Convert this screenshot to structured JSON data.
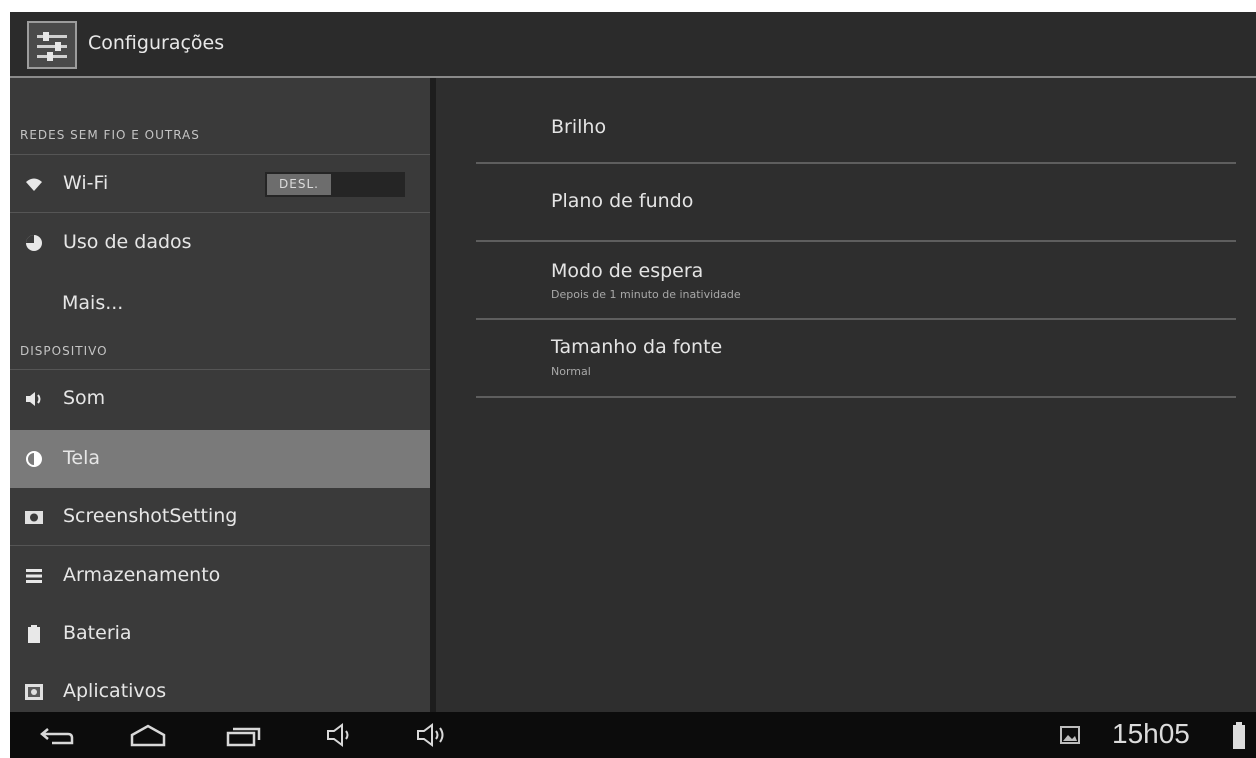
{
  "actionbar": {
    "title": "Configurações",
    "app_icon": "settings-icon"
  },
  "sections": [
    {
      "label": "REDES SEM FIO E OUTRAS"
    },
    {
      "label": "DISPOSITIVO"
    }
  ],
  "wifi": {
    "label": "Wi-Fi",
    "icon": "wifi-icon",
    "toggle_label": "DESL."
  },
  "items": [
    {
      "label": "Uso de dados",
      "icon": "data-usage-icon"
    },
    {
      "label": "Mais..."
    },
    {
      "label": "Som",
      "icon": "volume-icon"
    },
    {
      "label": "Tela",
      "icon": "brightness-icon",
      "selected": true
    },
    {
      "label": "ScreenshotSetting",
      "icon": "camera-icon"
    },
    {
      "label": "Armazenamento",
      "icon": "storage-icon"
    },
    {
      "label": "Bateria",
      "icon": "battery-icon"
    },
    {
      "label": "Aplicativos",
      "icon": "apps-icon"
    }
  ],
  "prefs": [
    {
      "title": "Brilho"
    },
    {
      "title": "Plano de fundo"
    },
    {
      "title": "Modo de espera",
      "summary": "Depois de 1 minuto de inatividade"
    },
    {
      "title": "Tamanho da fonte",
      "summary": "Normal"
    }
  ],
  "statusbar": {
    "time": "15h05",
    "icons": [
      "gallery-notification-icon",
      "battery-status-icon"
    ]
  },
  "navbar": {
    "buttons": [
      "back-icon",
      "home-icon",
      "recent-apps-icon",
      "volume-down-icon",
      "volume-up-icon"
    ]
  },
  "colors": {
    "background": "#2f2f2f",
    "selected": "#7a7a7a",
    "navbar": "#0c0c0c"
  }
}
